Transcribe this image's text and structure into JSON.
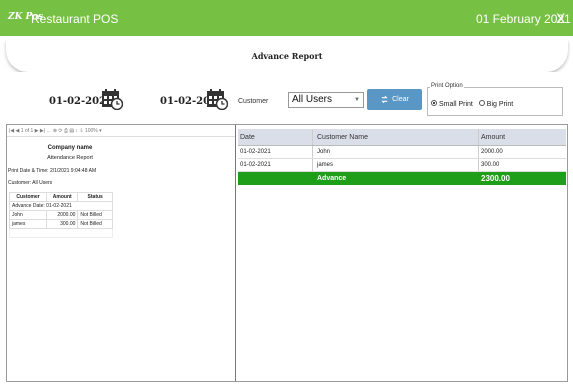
{
  "titlebar": {
    "logo": "ZK Pos",
    "app_title": "Restaurant POS",
    "date": "01 February 2021",
    "close_glyph": "X"
  },
  "page": {
    "title": "Advance Report"
  },
  "filters": {
    "from_date": "01-02-2021",
    "to_date": "01-02-2021",
    "customer_label": "Customer",
    "customer_value": "All Users",
    "clear_label": "Clear",
    "print_option_label": "Print Option",
    "small_print": "Small Print",
    "big_print": "Big Print",
    "selected_print": "Small Print"
  },
  "viewer": {
    "toolbar_text": "|◀ ◀ 1 of 1 ▶ ▶| ← ⊗ ⟳ ⎙ ▤ ↕ ⇩ 100% ▾",
    "company": "Company name",
    "report_title": "Attendance Report",
    "print_datetime": "Print Date & Time: 2/1/2021 9:04:48 AM",
    "customer_line": "Customer: All Users",
    "columns": [
      "Customer",
      "Amount",
      "Status"
    ],
    "advance_date": "Advance Date: 01-02-2021",
    "rows": [
      {
        "customer": "John",
        "amount": "2000.00",
        "status": "Not Billed"
      },
      {
        "customer": "james",
        "amount": "300.00",
        "status": "Not Billed"
      }
    ]
  },
  "grid": {
    "headers": [
      "Date",
      "Customer Name",
      "Amount"
    ],
    "rows": [
      {
        "date": "01-02-2021",
        "name": "John",
        "amount": "2000.00"
      },
      {
        "date": "01-02-2021",
        "name": "james",
        "amount": "300.00"
      }
    ],
    "total_label": "Advance",
    "total_value": "2300.00"
  },
  "colors": {
    "accent": "#76c043",
    "total_row": "#1f9e1a",
    "clear_button": "#5a97c4"
  }
}
